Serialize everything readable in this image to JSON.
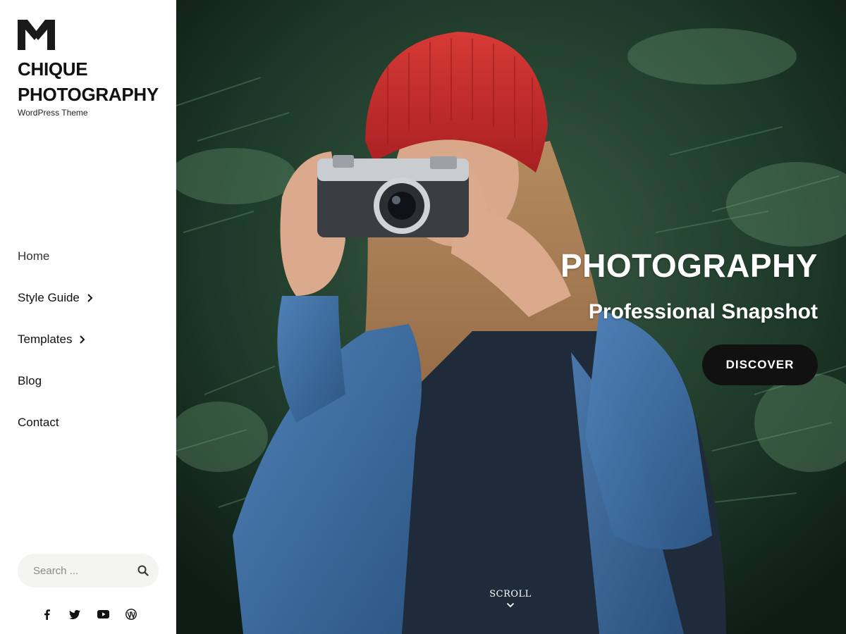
{
  "site": {
    "title_line1": "CHIQUE",
    "title_line2": "PHOTOGRAPHY",
    "tagline": "WordPress Theme"
  },
  "nav": {
    "items": [
      {
        "label": "Home",
        "has_submenu": false
      },
      {
        "label": "Style Guide",
        "has_submenu": true
      },
      {
        "label": "Templates",
        "has_submenu": true
      },
      {
        "label": "Blog",
        "has_submenu": false
      },
      {
        "label": "Contact",
        "has_submenu": false
      }
    ]
  },
  "search": {
    "placeholder": "Search ...",
    "icon": "search-icon"
  },
  "social": {
    "icons": [
      "facebook-icon",
      "twitter-icon",
      "youtube-icon",
      "wordpress-icon"
    ]
  },
  "hero": {
    "title": "PHOTOGRAPHY",
    "subtitle": "Professional Snapshot",
    "button_label": "DISCOVER",
    "scroll_label": "SCROLL"
  },
  "colors": {
    "button_bg": "#111111",
    "text_dark": "#111111",
    "hat_red": "#c6262a",
    "shirt_denim": "#3f6ea3"
  }
}
